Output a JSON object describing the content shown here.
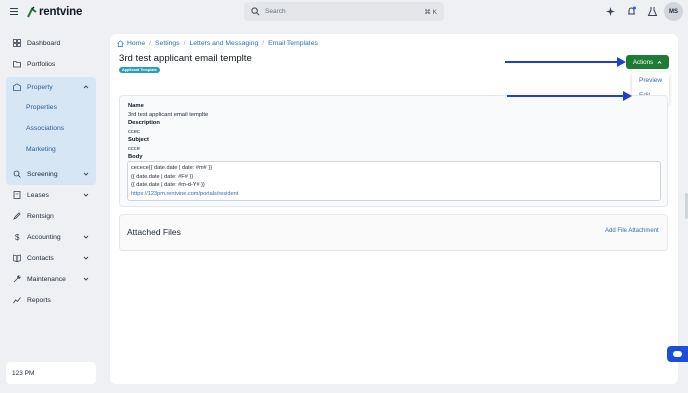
{
  "app": {
    "brand": "rentvine",
    "search_placeholder": "Search",
    "search_shortcut": "⌘ K",
    "user_initials": "MS"
  },
  "sidebar": {
    "items": [
      {
        "label": "Dashboard",
        "icon": "grid-icon"
      },
      {
        "label": "Portfolios",
        "icon": "folder-icon"
      },
      {
        "label": "Property",
        "icon": "property-icon"
      },
      {
        "label": "Screening",
        "icon": "screening-icon"
      },
      {
        "label": "Leases",
        "icon": "lease-icon"
      },
      {
        "label": "Rentsign",
        "icon": "sign-icon"
      },
      {
        "label": "Accounting",
        "icon": "dollar-icon"
      },
      {
        "label": "Contacts",
        "icon": "contacts-icon"
      },
      {
        "label": "Maintenance",
        "icon": "wrench-icon"
      },
      {
        "label": "Reports",
        "icon": "reports-icon"
      }
    ],
    "property_sub": [
      "Properties",
      "Associations",
      "Marketing"
    ],
    "clock": "123 PM"
  },
  "breadcrumb": [
    "Home",
    "Settings",
    "Letters and Messaging",
    "Email Templates"
  ],
  "page": {
    "title": "3rd test applicant email templte",
    "badge": "Applicant Template"
  },
  "actions": {
    "label": "Actions",
    "items": [
      "Preview",
      "Edit"
    ]
  },
  "details": {
    "name_label": "Name",
    "name_value": "3rd test applicant email templte",
    "description_label": "Description",
    "description_value": "ccec",
    "subject_label": "Subject",
    "subject_value": "ccce",
    "body_label": "Body",
    "body_lines": [
      "cecece{{ date.date | date: #m# }}",
      "{{ date.date | date: #F# }}",
      "{{ date.date | date: #m-d-Y# }}"
    ],
    "body_link": "https://123pm.rentvine.com/portals/resident"
  },
  "files": {
    "title": "Attached Files",
    "add_link": "Add File Attachment"
  },
  "colors": {
    "accent_green": "#1e7a34",
    "link_blue": "#2f6fb0",
    "annotation_blue": "#1f3fd0",
    "badge_teal": "#2a9fb8"
  }
}
